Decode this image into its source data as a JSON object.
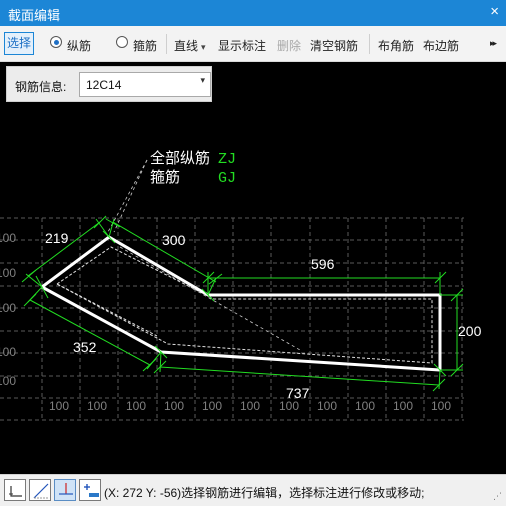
{
  "window": {
    "title": "截面编辑",
    "close_glyph": "×"
  },
  "toolbar": {
    "select": "选择",
    "radio_longitudinal": "纵筋",
    "radio_stirrup": "箍筋",
    "line": "直线",
    "show_annotation": "显示标注",
    "delete": "删除",
    "clear_rebar": "清空钢筋",
    "corner_rebar": "布角筋",
    "edge_rebar": "布边筋",
    "more_glyph": "▸▸",
    "dropdown_glyph": "▾"
  },
  "rebar_info": {
    "label": "钢筋信息:",
    "value": "12C14",
    "arrow_glyph": "▾"
  },
  "drawing": {
    "legend_all_longitudinal": "全部纵筋",
    "legend_all_longitudinal_code": "ZJ",
    "legend_stirrup": "箍筋",
    "legend_stirrup_code": "GJ",
    "dim_219": "219",
    "dim_300": "300",
    "dim_596": "596",
    "dim_200": "200",
    "dim_352": "352",
    "dim_737": "737",
    "grid_label": "100",
    "colors": {
      "background": "#000000",
      "outline": "#ffffff",
      "dimension": "#22dd22",
      "grid": "#5a5a5a",
      "grid_text": "#808080",
      "code_text": "#22dd22"
    }
  },
  "status": {
    "text": "(X: 272 Y: -56)选择钢筋进行编辑，选择标注进行修改或移动;",
    "icons": [
      "orthogonal-snap-icon",
      "polar-snap-icon",
      "intersection-snap-icon",
      "add-point-icon"
    ]
  }
}
